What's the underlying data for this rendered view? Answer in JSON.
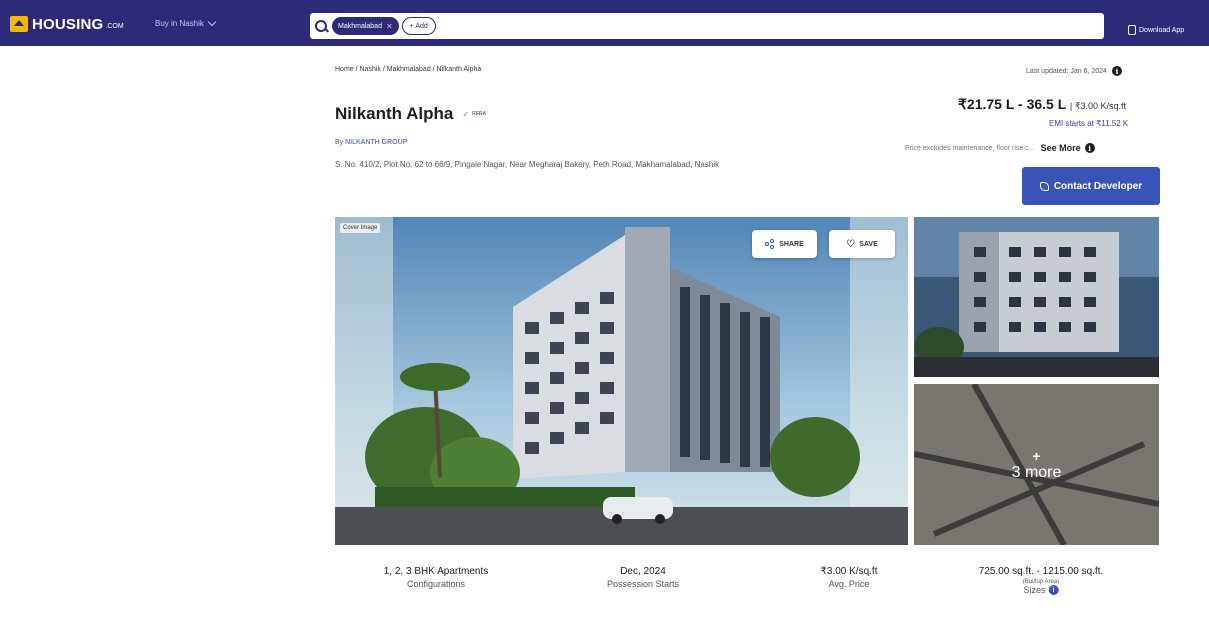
{
  "header": {
    "logo_text": "HOUSING",
    "logo_suffix": ".COM",
    "city_select": "Buy in Nashik",
    "search_chip": "Makhmalabad",
    "add_button": "+ Add",
    "download_app": "Download App"
  },
  "breadcrumb": "Home / Nashik / Makhmalabad / Nilkanth Alpha",
  "last_updated": "Last updated: Jan 6, 2024",
  "project": {
    "name": "Nilkanth Alpha",
    "rera": "RERA",
    "builder_prefix": "By",
    "builder_name": "NILKANTH GROUP",
    "address": "S. No. 410/2, Plot No. 62 to 66/9, Pingale Nagar, Near Megharaj Bakery, Peth Road, Makhamalabad, Nashik"
  },
  "pricing": {
    "range": "₹21.75 L - 36.5 L",
    "per_sqft": "₹3.00 K/sq.ft",
    "emi": "EMI starts at ₹11.52 K",
    "note": "Price excludes maintenance, floor rise c...",
    "see_more": "See More"
  },
  "contact_button": "Contact Developer",
  "gallery": {
    "cover_tag": "Cover Image",
    "share": "SHARE",
    "save": "SAVE",
    "more_plus": "+",
    "more_text": "3 more"
  },
  "stats": {
    "config_value": "1, 2, 3 BHK Apartments",
    "config_label": "Configurations",
    "possession_value": "Dec, 2024",
    "possession_label": "Possession Starts",
    "avg_value": "₹3.00 K/sq.ft",
    "avg_label": "Avg. Price",
    "size_value": "725.00 sq.ft. - 1215.00 sq.ft.",
    "size_sub": "(Builtup Area)",
    "size_label": "Sizes"
  },
  "colors": {
    "brand": "#2d2a7a",
    "accent": "#3a53b8",
    "logo": "#f5b800"
  }
}
